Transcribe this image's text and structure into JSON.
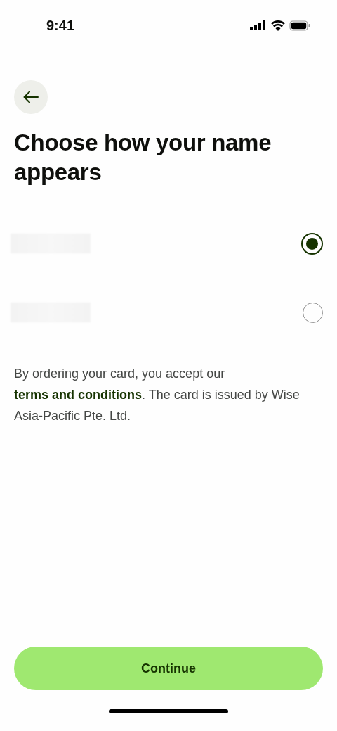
{
  "status_bar": {
    "time": "9:41"
  },
  "title": "Choose how your name appears",
  "options": [
    {
      "kind": "redacted",
      "selected": true
    },
    {
      "kind": "redacted",
      "selected": false
    }
  ],
  "notice": {
    "before": "By ordering your card, you accept our ",
    "link": "terms and conditions",
    "after": ". The card is issued by Wise Asia-Pacific Pte. Ltd."
  },
  "button": {
    "label": "Continue"
  }
}
